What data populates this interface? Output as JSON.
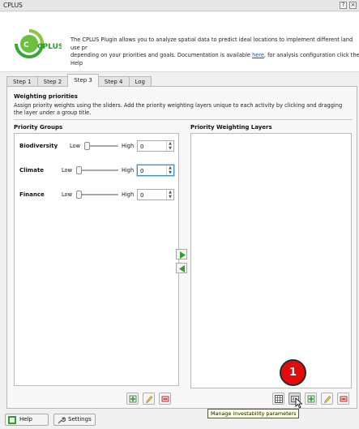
{
  "window": {
    "title": "CPLUS",
    "help_glyph": "?",
    "close_glyph": "×"
  },
  "logo": {
    "text": "CPLUS",
    "icon": "cplus-logo"
  },
  "header": {
    "desc_before_link": "The CPLUS Plugin allows you to analyze spatial data to predict ideal locations to implement different land use pr",
    "desc_line2_before": "depending on your priorities and goals. Documentation is available ",
    "link_text": "here",
    "desc_after_link": ", for analysis configuration click the Help"
  },
  "tabs": [
    {
      "label": "Step 1"
    },
    {
      "label": "Step 2"
    },
    {
      "label": "Step 3"
    },
    {
      "label": "Step 4"
    },
    {
      "label": "Log"
    }
  ],
  "active_tab": "Step 3",
  "section": {
    "title": "Weighting priorities",
    "description": "Assign priority weights using the sliders. Add the priority weighting layers unique to each activity by clicking and dragging the layer under a group title."
  },
  "priority_groups": {
    "title": "Priority Groups",
    "rows": [
      {
        "label": "Biodiversity",
        "low": "Low",
        "high": "High",
        "value": "0",
        "slider_fraction": 0.0
      },
      {
        "label": "Climate",
        "low": "Low",
        "high": "High",
        "value": "0",
        "slider_fraction": 0.0,
        "focused": true
      },
      {
        "label": "Finance",
        "low": "Low",
        "high": "High",
        "value": "0",
        "slider_fraction": 0.0
      }
    ],
    "spin_arrows": "▲▼"
  },
  "priority_layers": {
    "title": "Priority Weighting Layers"
  },
  "tooltip": "Manage investability parameters",
  "marker_label": "1",
  "bottom": {
    "help_label": "Help",
    "settings_label": "Settings"
  },
  "colors": {
    "accent_green": "#2e9c2e",
    "marker_red": "#e10d0d",
    "link_blue": "#1a4fd0"
  }
}
